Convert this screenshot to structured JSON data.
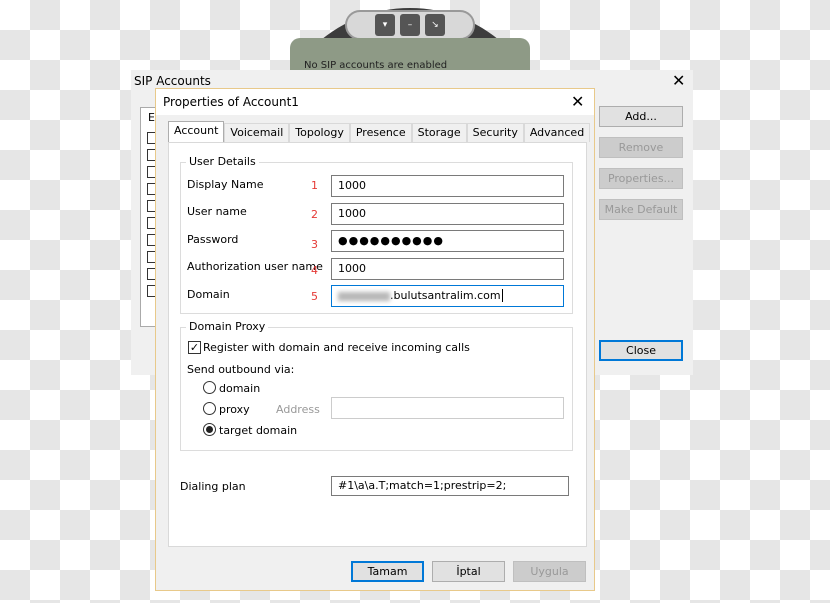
{
  "phone": {
    "screen_text": "No SIP accounts are enabled",
    "buttons": [
      "▾",
      "–",
      "↘"
    ]
  },
  "sip_accounts": {
    "title": "SIP Accounts",
    "list_header_partial": "Er",
    "buttons": {
      "add": "Add...",
      "remove": "Remove",
      "properties": "Properties...",
      "make_default": "Make Default",
      "close": "Close"
    }
  },
  "dialog": {
    "title": "Properties of Account1",
    "tabs": [
      "Account",
      "Voicemail",
      "Topology",
      "Presence",
      "Storage",
      "Security",
      "Advanced"
    ],
    "active_tab": "Account",
    "user_details": {
      "legend": "User Details",
      "fields": [
        {
          "label": "Display Name",
          "step": "1",
          "value": "1000"
        },
        {
          "label": "User name",
          "step": "2",
          "value": "1000"
        },
        {
          "label": "Password",
          "step": "3",
          "value": "●●●●●●●●●●"
        },
        {
          "label": "Authorization user name",
          "step": "4",
          "value": "1000"
        },
        {
          "label": "Domain",
          "step": "5",
          "value": ".bulutsantralim.com"
        }
      ]
    },
    "domain_proxy": {
      "legend": "Domain Proxy",
      "register_label": "Register with domain and receive incoming calls",
      "register_checked": true,
      "send_via_label": "Send outbound via:",
      "options": [
        "domain",
        "proxy",
        "target domain"
      ],
      "selected": "target domain",
      "address_label": "Address",
      "address_value": ""
    },
    "dialing_plan": {
      "label": "Dialing plan",
      "value": "#1\\a\\a.T;match=1;prestrip=2;"
    },
    "buttons": {
      "ok": "Tamam",
      "cancel": "İptal",
      "apply": "Uygula"
    }
  },
  "colors": {
    "accent": "#0078d7",
    "step_number": "#e53935"
  }
}
